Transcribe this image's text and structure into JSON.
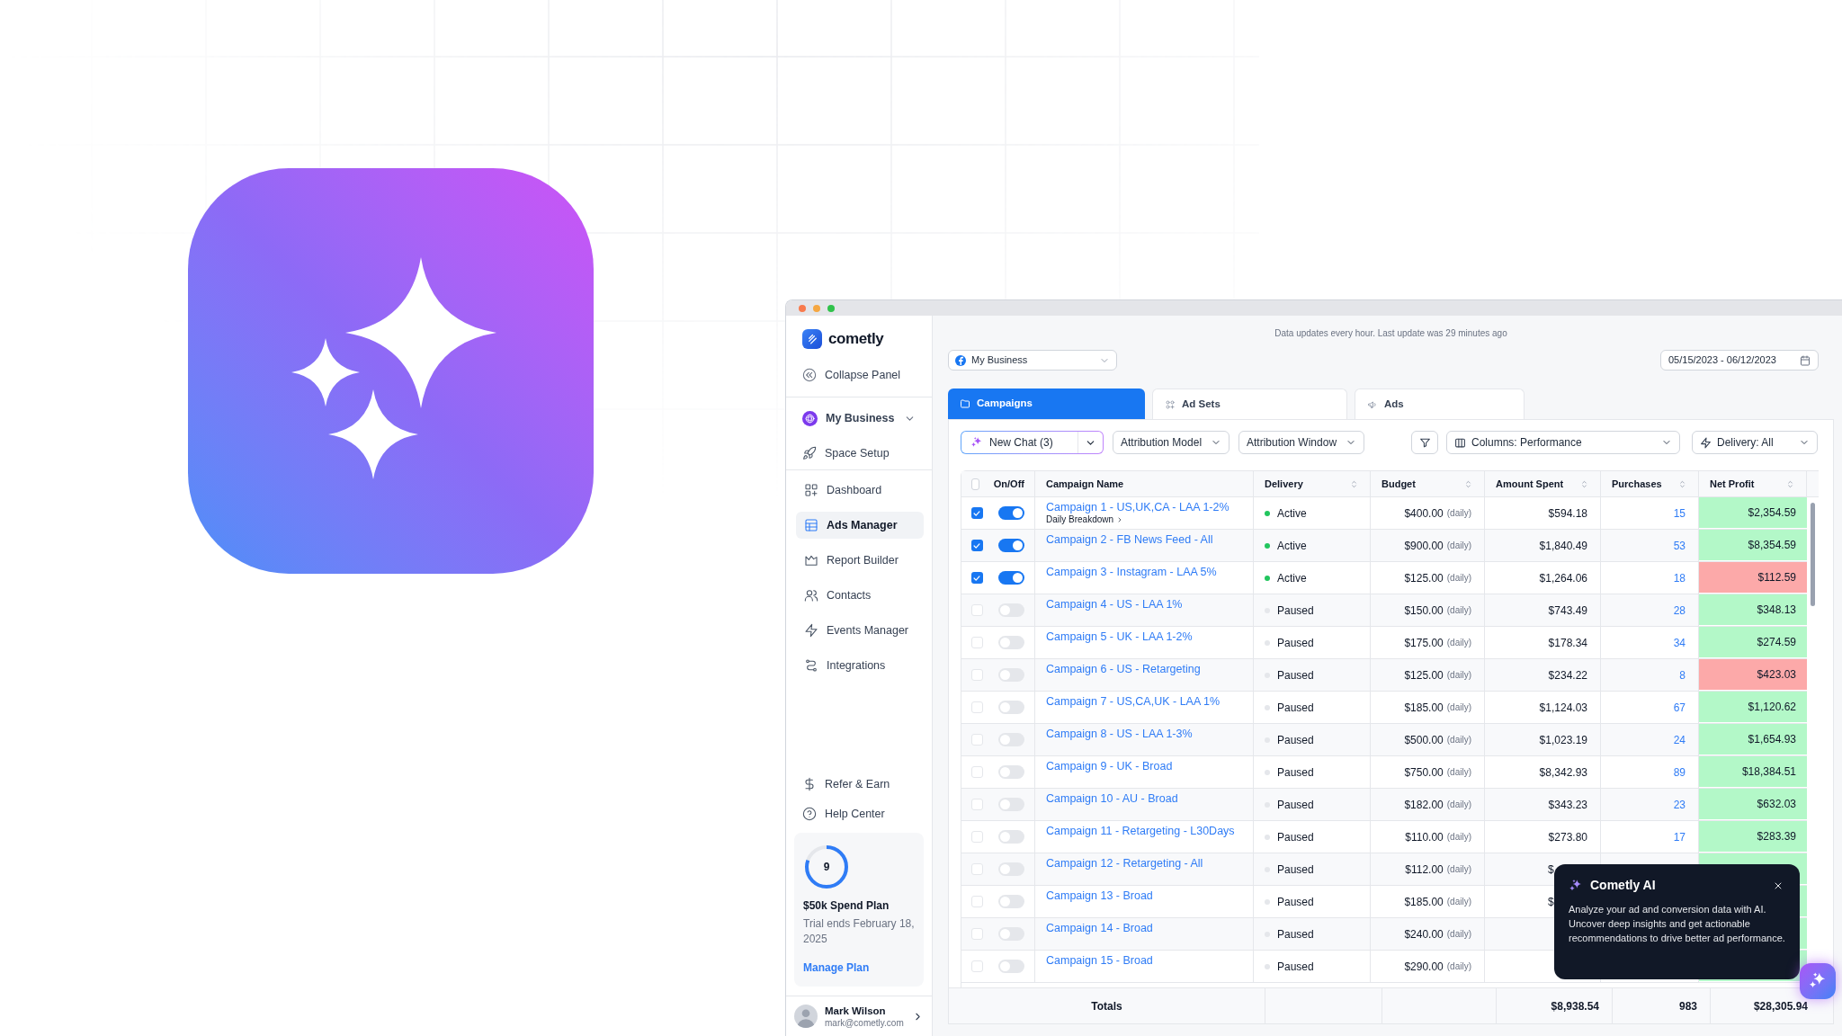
{
  "sidebar": {
    "brand": "cometly",
    "collapse": "Collapse Panel",
    "workspace": "My Business",
    "setup": "Space Setup",
    "items": [
      {
        "label": "Dashboard",
        "selected": false
      },
      {
        "label": "Ads Manager",
        "selected": true
      },
      {
        "label": "Report Builder",
        "selected": false
      },
      {
        "label": "Contacts",
        "selected": false
      },
      {
        "label": "Events Manager",
        "selected": false
      },
      {
        "label": "Integrations",
        "selected": false
      }
    ],
    "footer_items": [
      "Refer & Earn",
      "Help Center"
    ],
    "plan": {
      "count": "9",
      "level": 0.8,
      "name": "$50k Spend Plan",
      "trial": "Trial ends February 18, 2025",
      "link": "Manage Plan"
    },
    "user": {
      "name": "Mark Wilson",
      "email": "mark@cometly.com"
    }
  },
  "header": {
    "notice": "Data updates every hour. Last update was 29 minutes ago",
    "account": "My Business",
    "date_range": "05/15/2023 - 06/12/2023"
  },
  "tabs": [
    {
      "label": "Campaigns",
      "selected": true
    },
    {
      "label": "Ad Sets",
      "selected": false
    },
    {
      "label": "Ads",
      "selected": false
    }
  ],
  "toolbar": {
    "chat": "New Chat (3)",
    "attribution_model": "Attribution Model",
    "attribution_window": "Attribution Window",
    "columns": "Columns: Performance",
    "delivery": "Delivery: All"
  },
  "table": {
    "select_all": {
      "checked": false
    },
    "columns": [
      {
        "label": "On/Off",
        "sortable": false
      },
      {
        "label": "Campaign Name",
        "sortable": false
      },
      {
        "label": "Delivery",
        "sortable": true
      },
      {
        "label": "Budget",
        "sortable": true
      },
      {
        "label": "Amount Spent",
        "sortable": true
      },
      {
        "label": "Purchases",
        "sortable": true
      },
      {
        "label": "Net Profit",
        "sortable": true
      }
    ],
    "rows": [
      {
        "checked": true,
        "on": true,
        "name": "Campaign 1 - US,UK,CA - LAA 1-2%",
        "breakdown": "Daily Breakdown",
        "delivery": {
          "label": "Active",
          "color": "#22c55e"
        },
        "budget": "$400.00",
        "period": "(daily)",
        "amount_spent": "$594.18",
        "purchases": "15",
        "net_profit": {
          "value": "$2,354.59",
          "color": "#b3f8c8"
        }
      },
      {
        "checked": true,
        "on": true,
        "name": "Campaign 2 - FB News Feed - All",
        "delivery": {
          "label": "Active",
          "color": "#22c55e"
        },
        "budget": "$900.00",
        "period": "(daily)",
        "amount_spent": "$1,840.49",
        "purchases": "53",
        "net_profit": {
          "value": "$8,354.59",
          "color": "#b3f8c8"
        }
      },
      {
        "checked": true,
        "on": true,
        "name": "Campaign 3 - Instagram - LAA 5%",
        "delivery": {
          "label": "Active",
          "color": "#22c55e"
        },
        "budget": "$125.00",
        "period": "(daily)",
        "amount_spent": "$1,264.06",
        "purchases": "18",
        "net_profit": {
          "value": "$112.59",
          "color": "#fca9a9"
        }
      },
      {
        "checked": false,
        "on": false,
        "name": "Campaign 4 - US - LAA 1%",
        "delivery": {
          "label": "Paused",
          "color": "#e5e7eb"
        },
        "budget": "$150.00",
        "period": "(daily)",
        "amount_spent": "$743.49",
        "purchases": "28",
        "net_profit": {
          "value": "$348.13",
          "color": "#b3f8c8"
        }
      },
      {
        "checked": false,
        "on": false,
        "name": "Campaign 5 - UK - LAA 1-2%",
        "delivery": {
          "label": "Paused",
          "color": "#e5e7eb"
        },
        "budget": "$175.00",
        "period": "(daily)",
        "amount_spent": "$178.34",
        "purchases": "34",
        "net_profit": {
          "value": "$274.59",
          "color": "#b3f8c8"
        }
      },
      {
        "checked": false,
        "on": false,
        "name": "Campaign 6 - US - Retargeting",
        "delivery": {
          "label": "Paused",
          "color": "#e5e7eb"
        },
        "budget": "$125.00",
        "period": "(daily)",
        "amount_spent": "$234.22",
        "purchases": "8",
        "net_profit": {
          "value": "$423.03",
          "color": "#fca9a9"
        }
      },
      {
        "checked": false,
        "on": false,
        "name": "Campaign 7 - US,CA,UK - LAA 1%",
        "delivery": {
          "label": "Paused",
          "color": "#e5e7eb"
        },
        "budget": "$185.00",
        "period": "(daily)",
        "amount_spent": "$1,124.03",
        "purchases": "67",
        "net_profit": {
          "value": "$1,120.62",
          "color": "#b3f8c8"
        }
      },
      {
        "checked": false,
        "on": false,
        "name": "Campaign 8 - US - LAA 1-3%",
        "delivery": {
          "label": "Paused",
          "color": "#e5e7eb"
        },
        "budget": "$500.00",
        "period": "(daily)",
        "amount_spent": "$1,023.19",
        "purchases": "24",
        "net_profit": {
          "value": "$1,654.93",
          "color": "#b3f8c8"
        }
      },
      {
        "checked": false,
        "on": false,
        "name": "Campaign 9 - UK - Broad",
        "delivery": {
          "label": "Paused",
          "color": "#e5e7eb"
        },
        "budget": "$750.00",
        "period": "(daily)",
        "amount_spent": "$8,342.93",
        "purchases": "89",
        "net_profit": {
          "value": "$18,384.51",
          "color": "#b3f8c8"
        }
      },
      {
        "checked": false,
        "on": false,
        "name": "Campaign 10 - AU - Broad",
        "delivery": {
          "label": "Paused",
          "color": "#e5e7eb"
        },
        "budget": "$182.00",
        "period": "(daily)",
        "amount_spent": "$343.23",
        "purchases": "23",
        "net_profit": {
          "value": "$632.03",
          "color": "#b3f8c8"
        }
      },
      {
        "checked": false,
        "on": false,
        "name": "Campaign 11 - Retargeting - L30Days",
        "delivery": {
          "label": "Paused",
          "color": "#e5e7eb"
        },
        "budget": "$110.00",
        "period": "(daily)",
        "amount_spent": "$273.80",
        "purchases": "17",
        "net_profit": {
          "value": "$283.39",
          "color": "#b3f8c8"
        }
      },
      {
        "checked": false,
        "on": false,
        "covered": true,
        "name": "Campaign 12 - Retargeting - All",
        "delivery": {
          "label": "Paused",
          "color": "#e5e7eb"
        },
        "budget": "$112.00",
        "period": "(daily)",
        "amount_spent": "$",
        "net_profit": {
          "color": "#b3f8c8"
        }
      },
      {
        "checked": false,
        "on": false,
        "covered": true,
        "name": "Campaign 13 - Broad",
        "delivery": {
          "label": "Paused",
          "color": "#e5e7eb"
        },
        "budget": "$185.00",
        "period": "(daily)",
        "amount_spent": "$",
        "net_profit": {
          "color": "#b3f8c8"
        }
      },
      {
        "checked": false,
        "on": false,
        "name": "Campaign 14 - Broad",
        "delivery": {
          "label": "Paused",
          "color": "#e5e7eb"
        },
        "budget": "$240.00",
        "period": "(daily)",
        "net_profit": {
          "color": "#b3f8c8"
        }
      },
      {
        "checked": false,
        "on": false,
        "name": "Campaign 15 - Broad",
        "delivery": {
          "label": "Paused",
          "color": "#e5e7eb"
        },
        "budget": "$290.00",
        "period": "(daily)",
        "net_profit": {
          "color": "#b3f8c8"
        }
      }
    ],
    "totals": {
      "label": "Totals",
      "amount_spent": "$8,938.54",
      "purchases": "983",
      "net_profit": "$28,305.94"
    }
  },
  "assistant_popup": {
    "title": "Cometly AI",
    "body": "Analyze your ad and conversion data with AI. Uncover deep insights and get actionable recommendations to drive better ad performance."
  }
}
